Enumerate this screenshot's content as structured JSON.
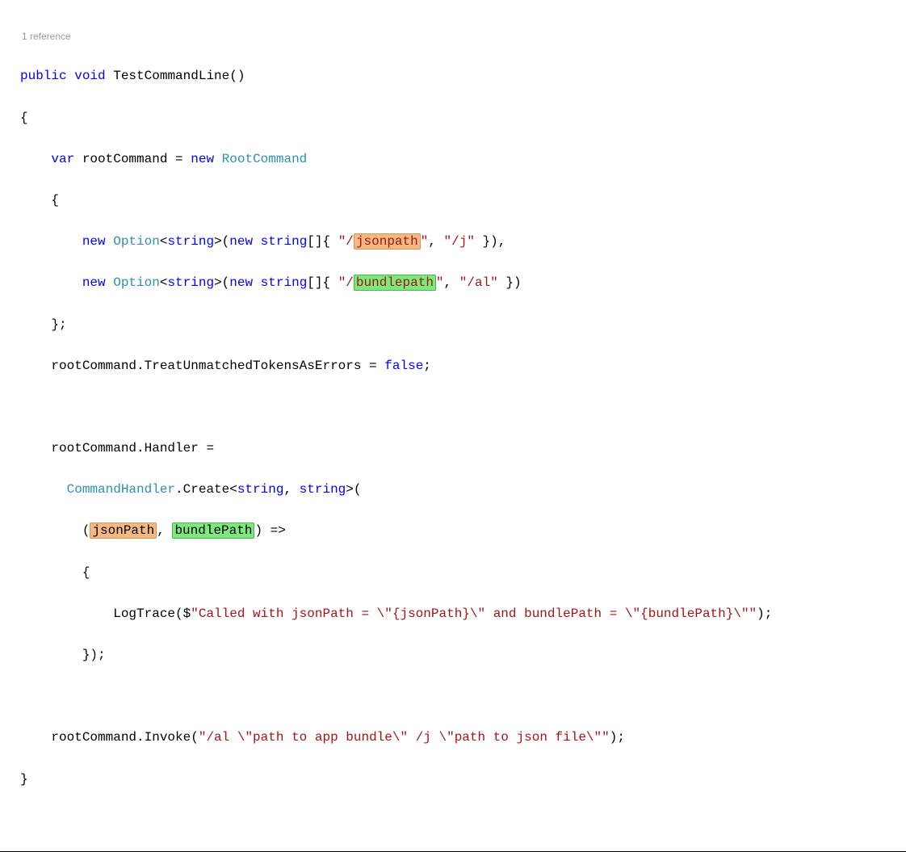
{
  "codelens": "1 reference",
  "code": {
    "l1_public": "public",
    "l1_void": "void",
    "l1_method": " TestCommandLine()",
    "l2_brace": "{",
    "l3_var": "var",
    "l3_mid": " rootCommand = ",
    "l3_new": "new",
    "l3_type": " RootCommand",
    "l4_brace": "{",
    "l5_new": "new",
    "l5_option": " Option",
    "l5_lt": "<",
    "l5_string": "string",
    "l5_gt_paren": ">(",
    "l5_new2": "new",
    "l5_string2": " string",
    "l5_arr": "[]{ ",
    "l5_q1": "\"/",
    "l5_hl": "jsonpath",
    "l5_q2": "\"",
    "l5_comma": ", ",
    "l5_str2": "\"/j\"",
    "l5_end": " }),",
    "l6_new": "new",
    "l6_option": " Option",
    "l6_lt": "<",
    "l6_string": "string",
    "l6_gt_paren": ">(",
    "l6_new2": "new",
    "l6_string2": " string",
    "l6_arr": "[]{ ",
    "l6_q1": "\"/",
    "l6_hl": "bundlepath",
    "l6_q2": "\"",
    "l6_comma": ", ",
    "l6_str2": "\"/al\"",
    "l6_end": " })",
    "l7_close": "};",
    "l8_a": "rootCommand.TreatUnmatchedTokensAsErrors = ",
    "l8_false": "false",
    "l8_semi": ";",
    "l10_a": "rootCommand.Handler =",
    "l11_type": "CommandHandler",
    "l11_a": ".Create<",
    "l11_s1": "string",
    "l11_c": ", ",
    "l11_s2": "string",
    "l11_end": ">(",
    "l12_open": "(",
    "l12_hl1": "jsonPath",
    "l12_comma": ", ",
    "l12_hl2": "bundlePath",
    "l12_close": ") =>",
    "l13_brace": "{",
    "l14_a": "LogTrace($",
    "l14_str": "\"Called with jsonPath = \\\"{jsonPath}\\\" and bundlePath = \\\"{bundlePath}\\\"\"",
    "l14_end": ");",
    "l15_close": "});",
    "l17_a": "rootCommand.Invoke(",
    "l17_str": "\"/al \\\"path to app bundle\\\" /j \\\"path to json file\\\"\"",
    "l17_end": ");",
    "l18_brace": "}"
  }
}
